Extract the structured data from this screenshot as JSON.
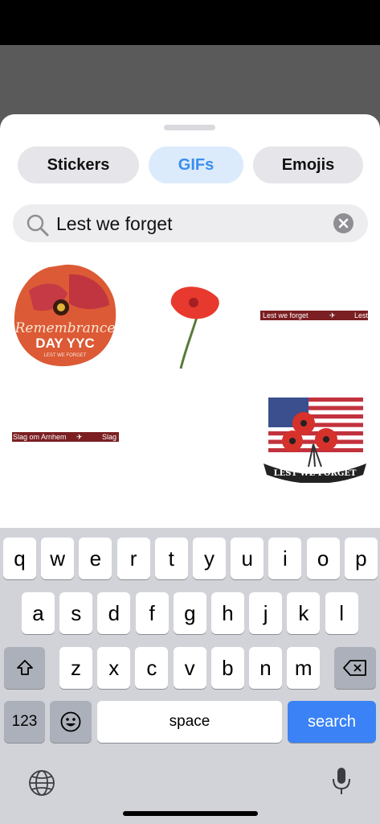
{
  "tabs": [
    {
      "label": "Stickers",
      "selected": false
    },
    {
      "label": "GIFs",
      "selected": true
    },
    {
      "label": "Emojis",
      "selected": false
    }
  ],
  "search": {
    "value": "Lest we forget",
    "icon": "magnifier-icon",
    "clear_icon": "clear-x-icon"
  },
  "results": {
    "gif1": {
      "line1": "Remembrance",
      "line2": "DAY YYC",
      "line3": "LEST WE FORGET"
    },
    "gif3": {
      "left": "Lest we forget",
      "right": "Lest"
    },
    "gif4": {
      "left": "Slag om Arnhem",
      "right": "Slag o"
    },
    "gif5": {
      "ribbon": "LEST WE FORGET"
    }
  },
  "keyboard": {
    "row1": [
      "q",
      "w",
      "e",
      "r",
      "t",
      "y",
      "u",
      "i",
      "o",
      "p"
    ],
    "row2": [
      "a",
      "s",
      "d",
      "f",
      "g",
      "h",
      "j",
      "k",
      "l"
    ],
    "row3": [
      "z",
      "x",
      "c",
      "v",
      "b",
      "n",
      "m"
    ],
    "numbers_label": "123",
    "space_label": "space",
    "search_label": "search",
    "accent": "#3a82f6"
  }
}
